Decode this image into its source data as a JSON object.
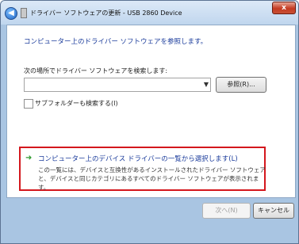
{
  "window": {
    "title": "ドライバー ソフトウェアの更新 - USB 2860 Device",
    "close_glyph": "x"
  },
  "main": {
    "heading": "コンピューター上のドライバー ソフトウェアを参照します。",
    "search_label": "次の場所でドライバー ソフトウェアを検索します:",
    "path_value": "",
    "browse_label": "参照(R)...",
    "include_subfolders_label": "サブフォルダーも検索する(I)",
    "include_subfolders_checked": false,
    "option": {
      "title": "コンピューター上のデバイス ドライバーの一覧から選択します(L)",
      "desc_line1": "この一覧には、デバイスと互換性があるインストールされたドライバー ソフトウェア",
      "desc_line2": "と、デバイスと同じカテゴリにあるすべてのドライバー ソフトウェアが表示されま",
      "desc_line3": "す。"
    }
  },
  "footer": {
    "next_label": "次へ(N)",
    "cancel_label": "キャンセル"
  },
  "colors": {
    "accent_text": "#1c3d9c",
    "highlight_border": "#d4171d",
    "arrow": "#2f9a2f"
  }
}
